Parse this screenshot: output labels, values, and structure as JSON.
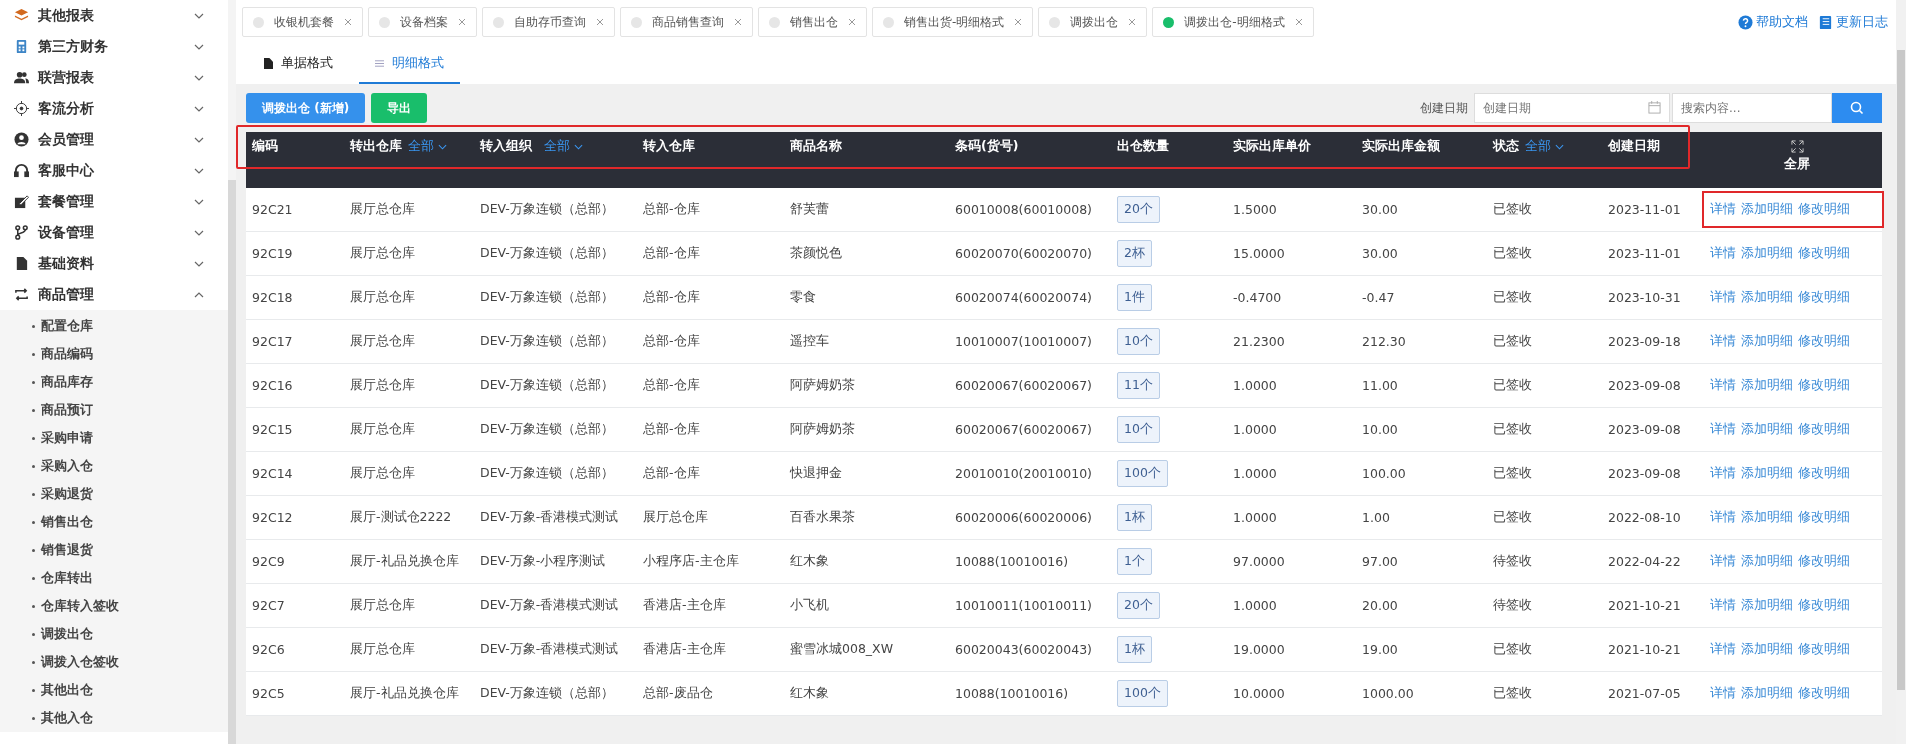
{
  "sidebar": {
    "items": [
      {
        "label": "其他报表",
        "expanded": false
      },
      {
        "label": "第三方财务",
        "expanded": false
      },
      {
        "label": "联营报表",
        "expanded": false
      },
      {
        "label": "客流分析",
        "expanded": false
      },
      {
        "label": "会员管理",
        "expanded": false
      },
      {
        "label": "客服中心",
        "expanded": false
      },
      {
        "label": "套餐管理",
        "expanded": false
      },
      {
        "label": "设备管理",
        "expanded": false
      },
      {
        "label": "基础资料",
        "expanded": false
      },
      {
        "label": "商品管理",
        "expanded": true,
        "children": [
          {
            "label": "配置仓库"
          },
          {
            "label": "商品编码"
          },
          {
            "label": "商品库存"
          },
          {
            "label": "商品预订"
          },
          {
            "label": "采购申请"
          },
          {
            "label": "采购入仓"
          },
          {
            "label": "采购退货"
          },
          {
            "label": "销售出仓"
          },
          {
            "label": "销售退货"
          },
          {
            "label": "仓库转出"
          },
          {
            "label": "仓库转入签收"
          },
          {
            "label": "调拨出仓"
          },
          {
            "label": "调拨入仓签收"
          },
          {
            "label": "其他出仓"
          },
          {
            "label": "其他入仓"
          }
        ]
      }
    ]
  },
  "tabs": [
    {
      "label": "收银机套餐",
      "selected": false
    },
    {
      "label": "设备档案",
      "selected": false
    },
    {
      "label": "自助存币查询",
      "selected": false
    },
    {
      "label": "商品销售查询",
      "selected": false
    },
    {
      "label": "销售出仓",
      "selected": false
    },
    {
      "label": "销售出货-明细格式",
      "selected": false
    },
    {
      "label": "调拨出仓",
      "selected": false
    },
    {
      "label": "调拨出仓-明细格式",
      "selected": true
    }
  ],
  "top_links": [
    {
      "label": "帮助文档"
    },
    {
      "label": "更新日志"
    }
  ],
  "view_tabs": [
    {
      "label": "单据格式",
      "selected": false
    },
    {
      "label": "明细格式",
      "selected": true
    }
  ],
  "toolbar": {
    "buttons": [
      {
        "label": "调拨出仓 (新增)",
        "kind": "primary"
      },
      {
        "label": "导出",
        "kind": "success"
      }
    ],
    "date_label": "创建日期",
    "date_field": {
      "placeholder": "创建日期"
    },
    "search_field": {
      "placeholder": "搜索内容..."
    }
  },
  "table": {
    "header_highlighted": true,
    "columns": [
      {
        "label": "编码"
      },
      {
        "label": "转出仓库",
        "filter": "全部"
      },
      {
        "label": "转入组织",
        "filter": "全部"
      },
      {
        "label": "转入仓库"
      },
      {
        "label": "商品名称"
      },
      {
        "label": "条码(货号)"
      },
      {
        "label": "出仓数量"
      },
      {
        "label": "实际出库单价"
      },
      {
        "label": "实际出库金额"
      },
      {
        "label": "状态",
        "filter": "全部"
      },
      {
        "label": "创建日期"
      },
      {
        "label": "全屏"
      }
    ],
    "rows": [
      {
        "cells": [
          "92C21",
          "展厅总仓库",
          "DEV-万象连锁（总部）",
          "总部-仓库",
          "舒芙蕾",
          "60010008(60010008)",
          "20个",
          "1.5000",
          "30.00",
          "已签收",
          "2023-11-01"
        ],
        "actions": [
          "详情",
          "添加明细",
          "修改明细"
        ],
        "actions_highlighted": true
      },
      {
        "cells": [
          "92C19",
          "展厅总仓库",
          "DEV-万象连锁（总部）",
          "总部-仓库",
          "茶颜悦色",
          "60020070(60020070)",
          "2杯",
          "15.0000",
          "30.00",
          "已签收",
          "2023-11-01"
        ],
        "actions": [
          "详情",
          "添加明细",
          "修改明细"
        ],
        "actions_highlighted": false
      },
      {
        "cells": [
          "92C18",
          "展厅总仓库",
          "DEV-万象连锁（总部）",
          "总部-仓库",
          "零食",
          "60020074(60020074)",
          "1件",
          "-0.4700",
          "-0.47",
          "已签收",
          "2023-10-31"
        ],
        "actions": [
          "详情",
          "添加明细",
          "修改明细"
        ],
        "actions_highlighted": false
      },
      {
        "cells": [
          "92C17",
          "展厅总仓库",
          "DEV-万象连锁（总部）",
          "总部-仓库",
          "遥控车",
          "10010007(10010007)",
          "10个",
          "21.2300",
          "212.30",
          "已签收",
          "2023-09-18"
        ],
        "actions": [
          "详情",
          "添加明细",
          "修改明细"
        ],
        "actions_highlighted": false
      },
      {
        "cells": [
          "92C16",
          "展厅总仓库",
          "DEV-万象连锁（总部）",
          "总部-仓库",
          "阿萨姆奶茶",
          "60020067(60020067)",
          "11个",
          "1.0000",
          "11.00",
          "已签收",
          "2023-09-08"
        ],
        "actions": [
          "详情",
          "添加明细",
          "修改明细"
        ],
        "actions_highlighted": false
      },
      {
        "cells": [
          "92C15",
          "展厅总仓库",
          "DEV-万象连锁（总部）",
          "总部-仓库",
          "阿萨姆奶茶",
          "60020067(60020067)",
          "10个",
          "1.0000",
          "10.00",
          "已签收",
          "2023-09-08"
        ],
        "actions": [
          "详情",
          "添加明细",
          "修改明细"
        ],
        "actions_highlighted": false
      },
      {
        "cells": [
          "92C14",
          "展厅总仓库",
          "DEV-万象连锁（总部）",
          "总部-仓库",
          "快退押金",
          "20010010(20010010)",
          "100个",
          "1.0000",
          "100.00",
          "已签收",
          "2023-09-08"
        ],
        "actions": [
          "详情",
          "添加明细",
          "修改明细"
        ],
        "actions_highlighted": false
      },
      {
        "cells": [
          "92C12",
          "展厅-测试仓2222",
          "DEV-万象-香港模式测试",
          "展厅总仓库",
          "百香水果茶",
          "60020006(60020006)",
          "1杯",
          "1.0000",
          "1.00",
          "已签收",
          "2022-08-10"
        ],
        "actions": [
          "详情",
          "添加明细",
          "修改明细"
        ],
        "actions_highlighted": false
      },
      {
        "cells": [
          "92C9",
          "展厅-礼品兑换仓库",
          "DEV-万象-小程序测试",
          "小程序店-主仓库",
          "红木象",
          "10088(10010016)",
          "1个",
          "97.0000",
          "97.00",
          "待签收",
          "2022-04-22"
        ],
        "actions": [
          "详情",
          "添加明细",
          "修改明细"
        ],
        "actions_highlighted": false
      },
      {
        "cells": [
          "92C7",
          "展厅总仓库",
          "DEV-万象-香港模式测试",
          "香港店-主仓库",
          "小飞机",
          "10010011(10010011)",
          "20个",
          "1.0000",
          "20.00",
          "待签收",
          "2021-10-21"
        ],
        "actions": [
          "详情",
          "添加明细",
          "修改明细"
        ],
        "actions_highlighted": false
      },
      {
        "cells": [
          "92C6",
          "展厅总仓库",
          "DEV-万象-香港模式测试",
          "香港店-主仓库",
          "蜜雪冰城008_XW",
          "60020043(60020043)",
          "1杯",
          "19.0000",
          "19.00",
          "已签收",
          "2021-10-21"
        ],
        "actions": [
          "详情",
          "添加明细",
          "修改明细"
        ],
        "actions_highlighted": false
      },
      {
        "cells": [
          "92C5",
          "展厅-礼品兑换仓库",
          "DEV-万象连锁（总部）",
          "总部-废品仓",
          "红木象",
          "10088(10010016)",
          "100个",
          "10.0000",
          "1000.00",
          "已签收",
          "2021-07-05"
        ],
        "actions": [
          "详情",
          "添加明细",
          "修改明细"
        ],
        "actions_highlighted": false
      }
    ]
  }
}
